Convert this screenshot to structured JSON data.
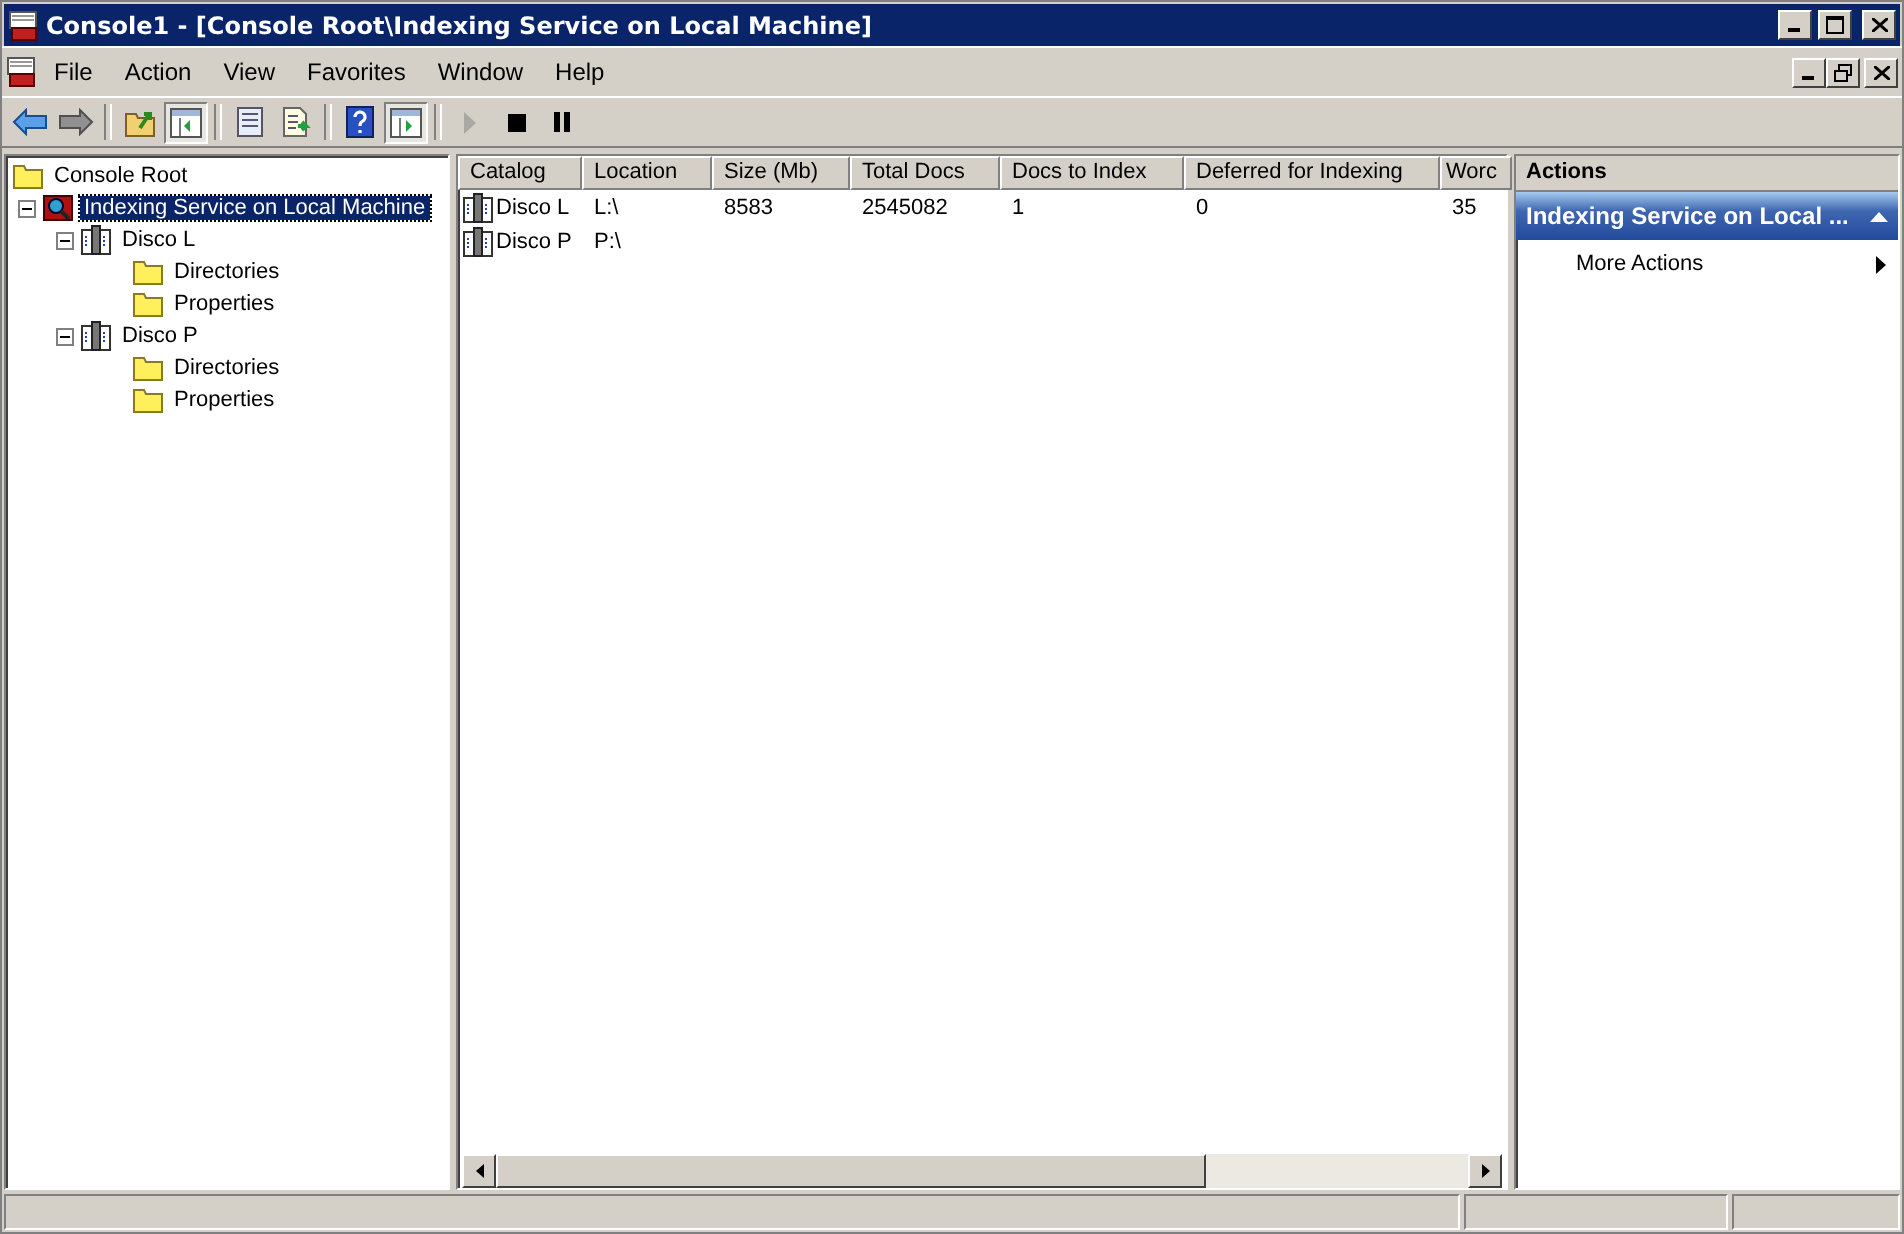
{
  "window": {
    "title": "Console1 - [Console Root\\Indexing Service on Local Machine]"
  },
  "menu": [
    "File",
    "Action",
    "View",
    "Favorites",
    "Window",
    "Help"
  ],
  "toolbar": [
    {
      "kind": "back",
      "disabled": false,
      "pressed": false
    },
    {
      "kind": "forward",
      "disabled": false,
      "pressed": false
    },
    {
      "kind": "separator"
    },
    {
      "kind": "up",
      "disabled": false,
      "pressed": false
    },
    {
      "kind": "tree",
      "disabled": false,
      "pressed": true
    },
    {
      "kind": "separator"
    },
    {
      "kind": "properties",
      "disabled": false,
      "pressed": false
    },
    {
      "kind": "export",
      "disabled": false,
      "pressed": false
    },
    {
      "kind": "separator"
    },
    {
      "kind": "help",
      "disabled": false,
      "pressed": false
    },
    {
      "kind": "actionpane",
      "disabled": false,
      "pressed": true
    },
    {
      "kind": "separator"
    },
    {
      "kind": "play",
      "disabled": true,
      "pressed": false
    },
    {
      "kind": "stop",
      "disabled": false,
      "pressed": false
    },
    {
      "kind": "pause",
      "disabled": false,
      "pressed": false
    }
  ],
  "tree": [
    {
      "label": "Console Root",
      "kind": "root",
      "selected": false,
      "children": [
        {
          "label": "Indexing Service on Local Machine",
          "kind": "service",
          "selected": true,
          "expanded": true,
          "children": [
            {
              "label": "Disco L",
              "kind": "catalog",
              "selected": false,
              "expanded": true,
              "children": [
                {
                  "label": "Directories",
                  "kind": "folder",
                  "selected": false
                },
                {
                  "label": "Properties",
                  "kind": "folder",
                  "selected": false
                }
              ]
            },
            {
              "label": "Disco P",
              "kind": "catalog",
              "selected": false,
              "expanded": true,
              "children": [
                {
                  "label": "Directories",
                  "kind": "folder",
                  "selected": false
                },
                {
                  "label": "Properties",
                  "kind": "folder",
                  "selected": false
                }
              ]
            }
          ]
        }
      ]
    }
  ],
  "table": {
    "columns": [
      "Catalog",
      "Location",
      "Size (Mb)",
      "Total Docs",
      "Docs to Index",
      "Deferred for Indexing",
      "Worc"
    ],
    "rows": [
      {
        "cells": [
          "Disco L",
          "L:\\",
          "8583",
          "2545082",
          "1",
          "0",
          "35"
        ]
      },
      {
        "cells": [
          "Disco P",
          "P:\\"
        ]
      }
    ]
  },
  "actions": {
    "title": "Actions",
    "section": {
      "label": "Indexing Service on Local ...",
      "expanded": true
    },
    "items": [
      {
        "label": "More Actions",
        "submenu": true
      }
    ]
  }
}
